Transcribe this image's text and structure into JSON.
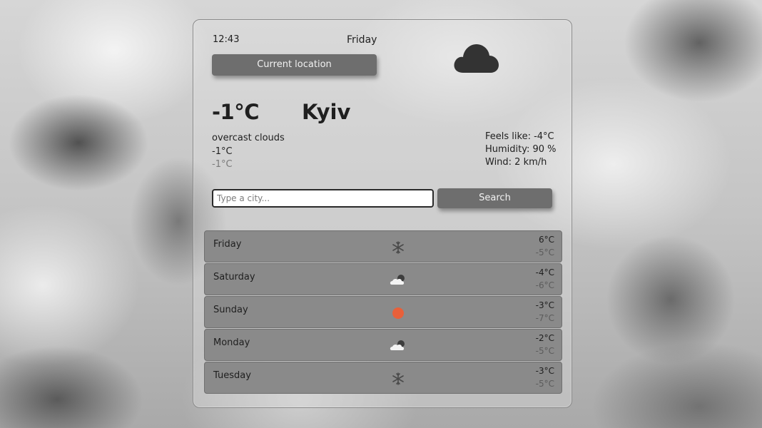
{
  "current": {
    "time": "12:43",
    "day": "Friday",
    "location_button": "Current location",
    "temp": "-1°C",
    "city": "Kyiv",
    "description": "overcast clouds",
    "temp_max": "-1°C",
    "temp_min": "-1°C",
    "icon": "cloud-icon",
    "feels_like": "Feels like: -4°C",
    "humidity": "Humidity: 90 %",
    "wind": "Wind: 2 km/h"
  },
  "search": {
    "placeholder": "Type a city...",
    "button_label": "Search"
  },
  "forecast": [
    {
      "day": "Friday",
      "icon": "snowflake-icon",
      "max": "6°C",
      "min": "-5°C"
    },
    {
      "day": "Saturday",
      "icon": "sun-behind-cloud-icon",
      "max": "-4°C",
      "min": "-6°C"
    },
    {
      "day": "Sunday",
      "icon": "sun-icon",
      "max": "-3°C",
      "min": "-7°C"
    },
    {
      "day": "Monday",
      "icon": "sun-behind-cloud-icon",
      "max": "-2°C",
      "min": "-5°C"
    },
    {
      "day": "Tuesday",
      "icon": "snowflake-icon",
      "max": "-3°C",
      "min": "-5°C"
    }
  ],
  "colors": {
    "button": "#6e6e6e",
    "row": "#8a8a8a",
    "sun": "#e8603a"
  }
}
